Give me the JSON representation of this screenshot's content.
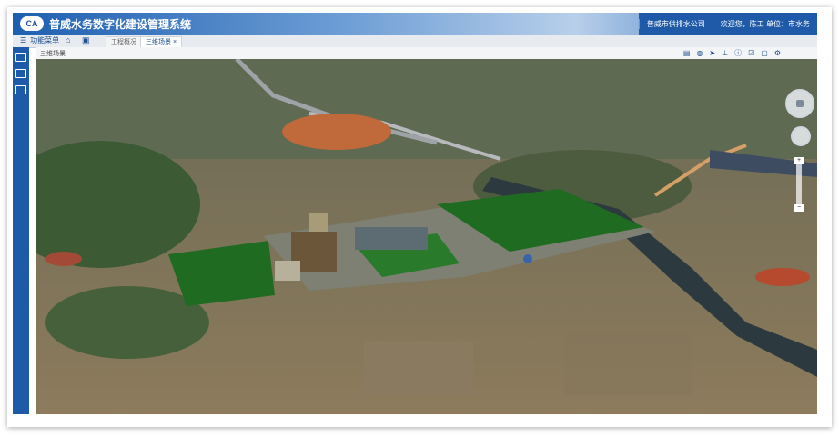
{
  "app": {
    "title": "普威水务数字化建设管理系统",
    "logo_text": "CA"
  },
  "header": {
    "user_info": "普威市供排水公司",
    "greeting": "欢迎您，陈工 单位：市水务"
  },
  "nav": {
    "menu_label": "功能菜单",
    "tabs": [
      {
        "label": "工程概况"
      },
      {
        "label": "三维场景"
      }
    ]
  },
  "toolbar": {
    "breadcrumb": "三维场景",
    "tools": [
      "layers-icon",
      "globe-icon",
      "fly-icon",
      "measure-icon",
      "info-icon",
      "checkbox-icon",
      "camera-icon",
      "settings-icon"
    ]
  },
  "sidebar": {
    "items": [
      "map-icon",
      "layers-icon",
      "box-icon"
    ]
  },
  "colors": {
    "primary": "#1d5aa8",
    "turf": "#1f6b22",
    "terrain": "#7a6f52"
  }
}
